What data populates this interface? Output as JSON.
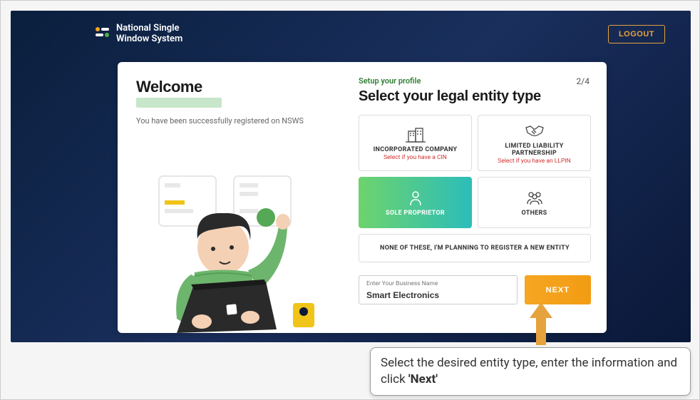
{
  "brand": {
    "line1": "National Single",
    "line2": "Window System"
  },
  "logout": "LOGOUT",
  "welcome": {
    "title": "Welcome",
    "subtitle": "You have been successfully registered on NSWS"
  },
  "step": "2/4",
  "setup_label": "Setup your profile",
  "section_title": "Select your legal entity type",
  "entities": {
    "incorporated": {
      "label": "INCORPORATED COMPANY",
      "sublabel": "Select if you have a CIN"
    },
    "llp": {
      "label": "LIMITED LIABILITY PARTNERSHIP",
      "sublabel": "Select if you have an LLPIN"
    },
    "sole": {
      "label": "SOLE PROPRIETOR"
    },
    "others": {
      "label": "OTHERS"
    },
    "none": {
      "label": "NONE OF THESE, I'M PLANNING TO REGISTER A NEW ENTITY"
    }
  },
  "business_input": {
    "label": "Enter Your Business Name",
    "value": "Smart Electronics"
  },
  "next_label": "NEXT",
  "callout": {
    "text_pre": "Select the desired entity type, enter the information and click ",
    "text_bold": "'Next'"
  }
}
